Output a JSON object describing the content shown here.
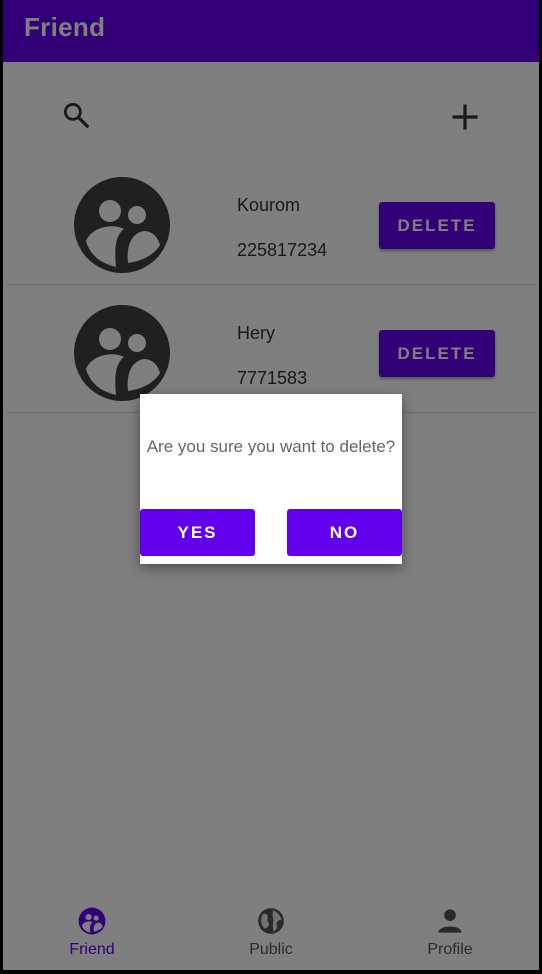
{
  "appbar": {
    "title": "Friend"
  },
  "toolbar": {
    "search_icon": "search-icon",
    "add_icon": "add-icon"
  },
  "friends": [
    {
      "name": "Kourom",
      "phone": "225817234",
      "delete_label": "DELETE"
    },
    {
      "name": "Hery",
      "phone": "7771583",
      "delete_label": "DELETE"
    }
  ],
  "dialog": {
    "message": "Are you sure you want to delete?",
    "yes_label": "YES",
    "no_label": "NO"
  },
  "bottom_nav": {
    "items": [
      {
        "label": "Friend",
        "icon": "group-icon",
        "active": true
      },
      {
        "label": "Public",
        "icon": "globe-icon",
        "active": false
      },
      {
        "label": "Profile",
        "icon": "person-icon",
        "active": false
      }
    ]
  },
  "colors": {
    "primary": "#6200ee",
    "icon_dark": "#404040",
    "overlay": "rgba(0,0,0,0.5)"
  }
}
